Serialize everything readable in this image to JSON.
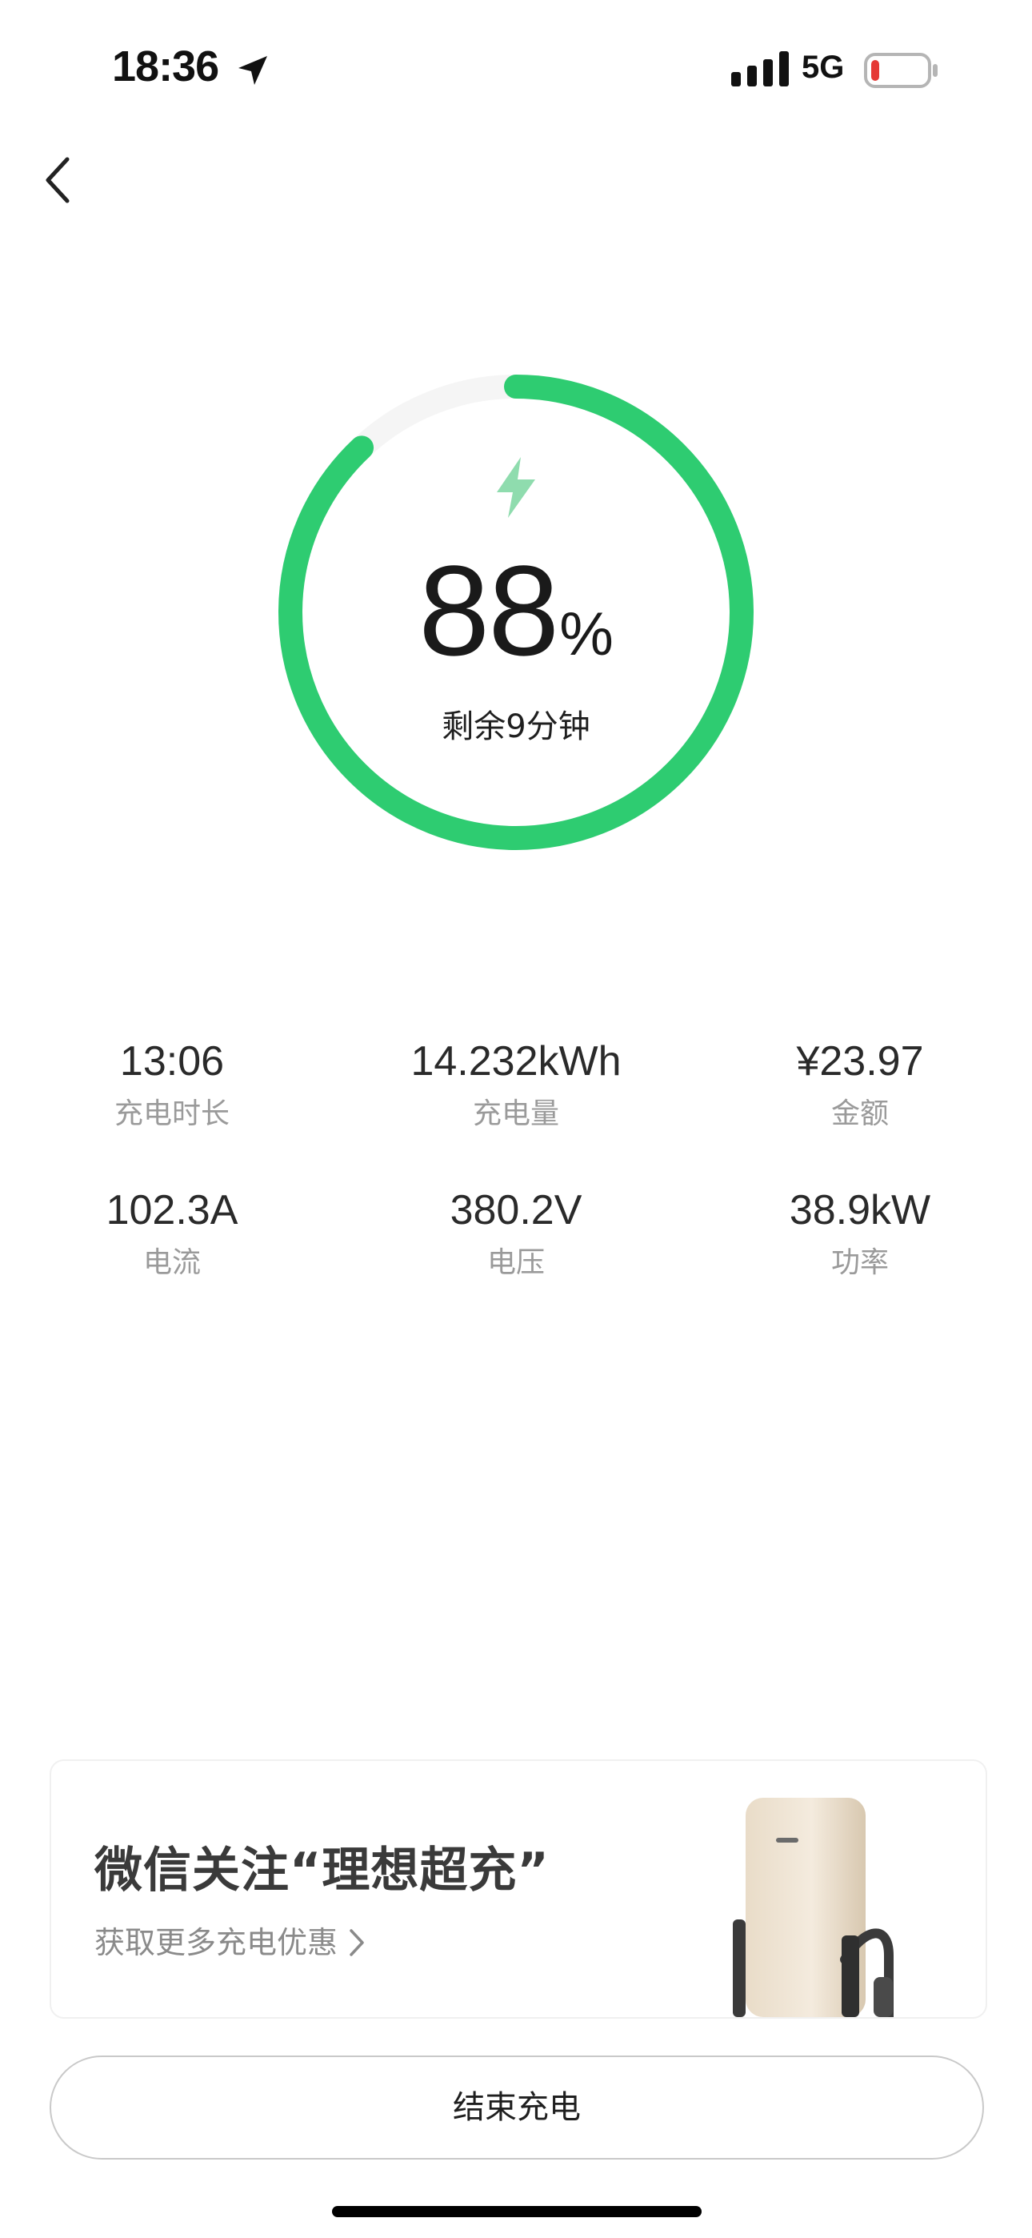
{
  "status_bar": {
    "time": "18:36",
    "network": "5G",
    "battery_color": "#e53935"
  },
  "nav": {
    "back_icon": "chevron-left-icon"
  },
  "charging": {
    "percent": 88,
    "percent_value": "88",
    "percent_unit": "%",
    "remaining": "剩余9分钟",
    "ring_color": "#2ecc71",
    "track_color": "#f5f5f5",
    "bolt_color": "#8fdcae"
  },
  "stats": [
    {
      "value": "13:06",
      "label": "充电时长"
    },
    {
      "value": "14.232kWh",
      "label": "充电量"
    },
    {
      "value": "¥23.97",
      "label": "金额"
    },
    {
      "value": "102.3A",
      "label": "电流"
    },
    {
      "value": "380.2V",
      "label": "电压"
    },
    {
      "value": "38.9kW",
      "label": "功率"
    }
  ],
  "promo": {
    "title": "微信关注“理想超充”",
    "subtitle": "获取更多充电优惠"
  },
  "actions": {
    "end_charging": "结束充电"
  }
}
